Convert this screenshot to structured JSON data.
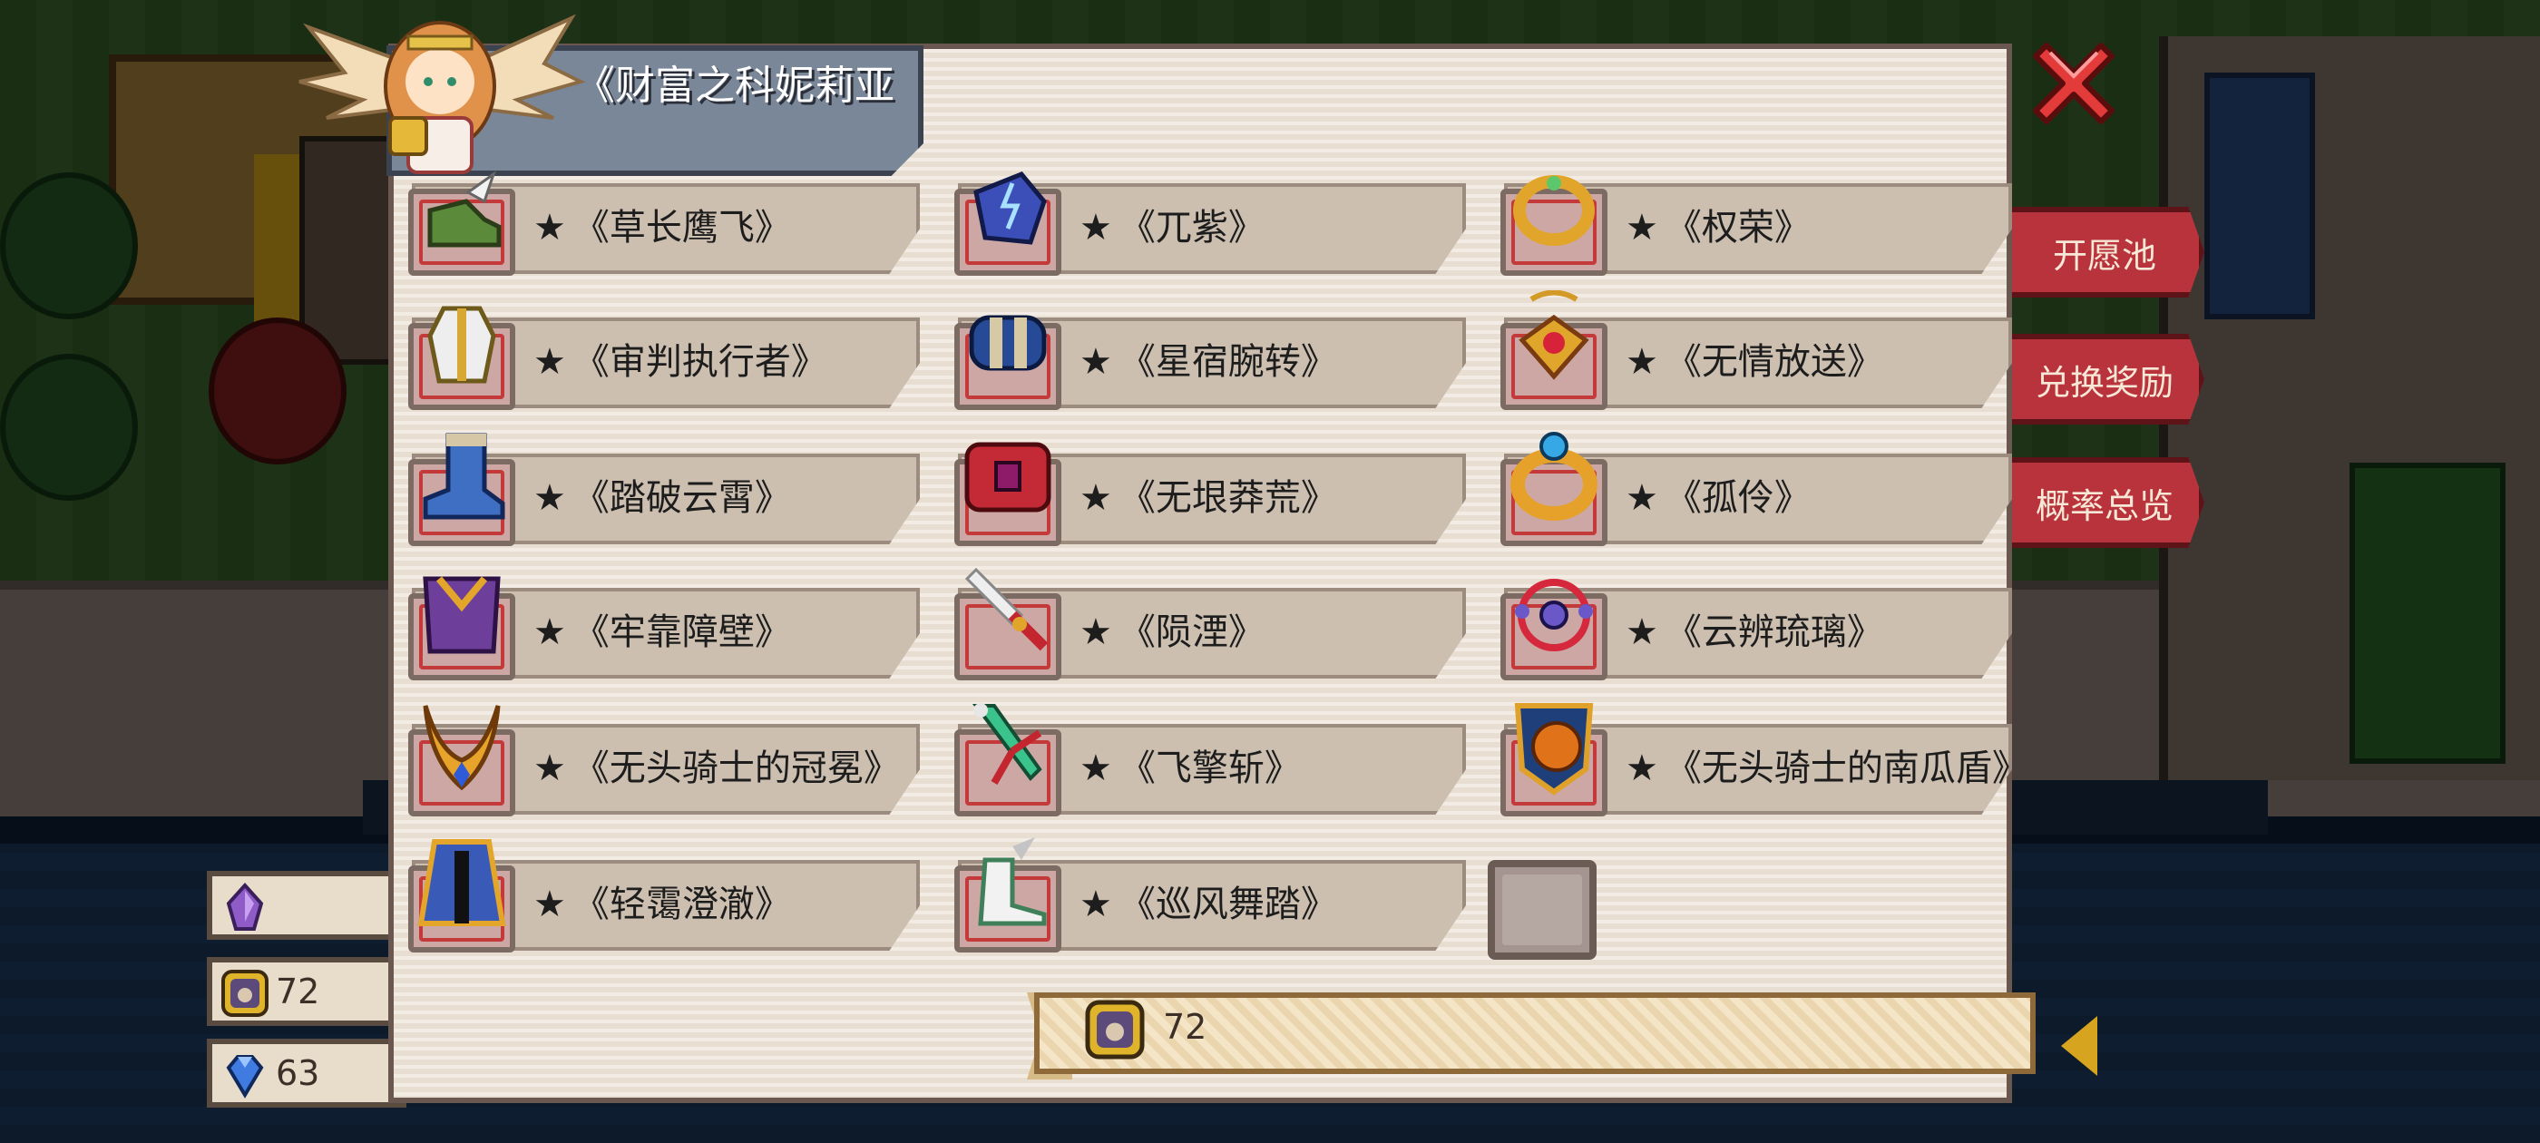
{
  "title": "《财富之科妮莉亚",
  "side_menu": [
    "开愿池",
    "兑换奖励",
    "概率总览"
  ],
  "currencies": [
    {
      "icon": "purple-crystal-icon",
      "value": ""
    },
    {
      "icon": "coin-token-icon",
      "value": "72"
    },
    {
      "icon": "blue-gem-icon",
      "value": "63"
    }
  ],
  "items": [
    {
      "star": "★",
      "name": "《草长鹰飞》",
      "icon": "winged-boot-icon"
    },
    {
      "star": "★",
      "name": "《兀紫》",
      "icon": "lightning-gauntlet-icon"
    },
    {
      "star": "★",
      "name": "《权荣》",
      "icon": "gold-ring-icon"
    },
    {
      "star": "★",
      "name": "《审判执行者》",
      "icon": "white-armor-icon"
    },
    {
      "star": "★",
      "name": "《星宿腕转》",
      "icon": "star-bracer-icon"
    },
    {
      "star": "★",
      "name": "《无情放送》",
      "icon": "ruby-amulet-icon"
    },
    {
      "star": "★",
      "name": "《踏破云霄》",
      "icon": "blue-boot-icon"
    },
    {
      "star": "★",
      "name": "《无垠莽荒》",
      "icon": "red-belt-icon"
    },
    {
      "star": "★",
      "name": "《孤伶》",
      "icon": "sapphire-ring-icon"
    },
    {
      "star": "★",
      "name": "《牢靠障壁》",
      "icon": "heavy-armor-icon"
    },
    {
      "star": "★",
      "name": "《陨湮》",
      "icon": "flame-dagger-icon"
    },
    {
      "star": "★",
      "name": "《云辨琉璃》",
      "icon": "orb-necklace-icon"
    },
    {
      "star": "★",
      "name": "《无头骑士的冠冕》",
      "icon": "horned-crown-icon"
    },
    {
      "star": "★",
      "name": "《飞擎斩》",
      "icon": "green-sword-icon"
    },
    {
      "star": "★",
      "name": "《无头骑士的南瓜盾》",
      "icon": "pumpkin-shield-icon"
    },
    {
      "star": "★",
      "name": "《轻霭澄澈》",
      "icon": "blue-robe-icon"
    },
    {
      "star": "★",
      "name": "《巡风舞踏》",
      "icon": "feather-boot-icon"
    }
  ],
  "cost": {
    "icon": "coin-token-icon",
    "value": "72"
  },
  "colors": {
    "accent_red": "#b8333b",
    "panel": "#ece2d5",
    "slot_border": "#c43a3a"
  }
}
